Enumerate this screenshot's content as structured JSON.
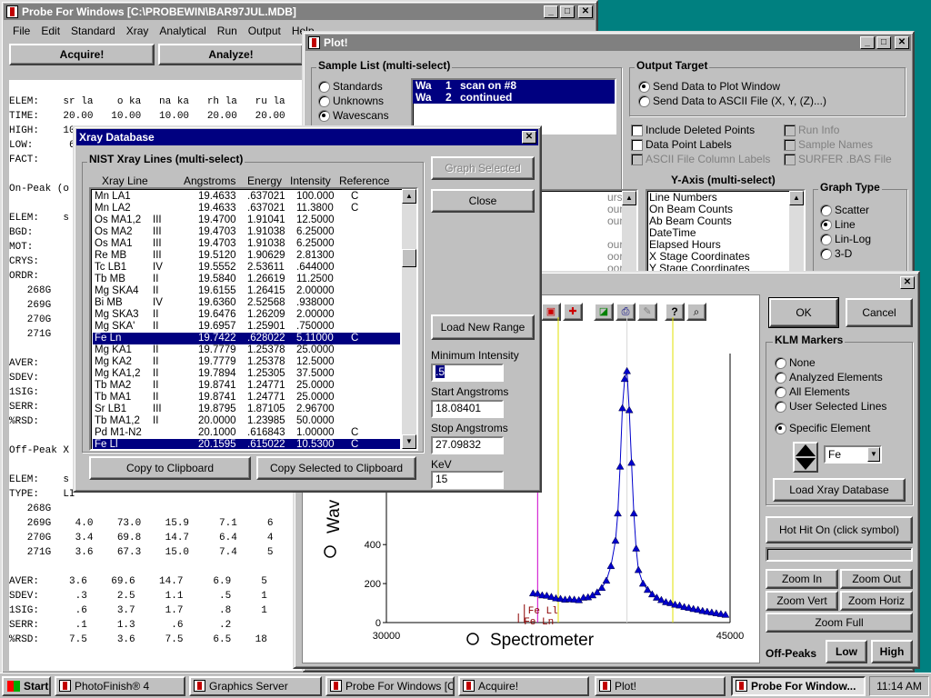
{
  "colors": {
    "desktop": "#008080",
    "titlebar_active": "#000080",
    "selection": "#000080",
    "marker": "#0000cc",
    "fe_line": "#8b0000",
    "klm_magenta": "#cc00cc",
    "klm_yellow": "#e0e000"
  },
  "probe": {
    "title": "Probe For Windows [C:\\PROBEWIN\\BAR97JUL.MDB]",
    "menu": [
      "File",
      "Edit",
      "Standard",
      "Xray",
      "Analytical",
      "Run",
      "Output",
      "Help"
    ],
    "acquire_label": "Acquire!",
    "analyze_label": "Analyze!",
    "lines": [
      "",
      "ELEM:    sr la    o ka   na ka   rh la   ru la",
      "TIME:    20.00   10.00   10.00   20.00   20.00",
      "HIGH:    10.00    5.00    5.00   10.00   10.00",
      "LOW:      6.00    5.00    5.00    6.00    6.00",
      "FACT:",
      "",
      "On-Peak (o",
      "",
      "ELEM:    s",
      "BGD:",
      "MOT:",
      "CRYS:",
      "ORDR:",
      "   268G    4",
      "   269G    4",
      "   270G    4",
      "   271G    4",
      "",
      "AVER:",
      "SDEV:",
      "1SIG:",
      "SERR:",
      "%RSD:",
      "",
      "Off-Peak X",
      "",
      "ELEM:    s",
      "TYPE:    LI",
      "   268G",
      "   269G    4.0    73.0    15.9     7.1     6",
      "   270G    3.4    69.8    14.7     6.4     4",
      "   271G    3.6    67.3    15.0     7.4     5",
      "",
      "AVER:     3.6    69.6    14.7     6.9     5",
      "SDEV:      .3     2.5     1.1      .5     1",
      "1SIG:      .6     3.7     1.7      .8     1",
      "SERR:      .1     1.3      .6      .2",
      "%RSD:     7.5     3.6     7.5     6.5    18"
    ]
  },
  "plot": {
    "title": "Plot!",
    "sample_list_label": "Sample List (multi-select)",
    "sample_types": [
      "Standards",
      "Unknowns",
      "Wavescans"
    ],
    "sample_items": [
      {
        "col1": "Wa",
        "col2": "1",
        "text": "scan on #8"
      },
      {
        "col1": "Wa",
        "col2": "2",
        "text": "continued"
      }
    ],
    "output_target_label": "Output Target",
    "output_options": [
      "Send Data to Plot Window",
      "Send Data to ASCII File (X, Y, (Z)...)"
    ],
    "checks_left": [
      "Include Deleted Points",
      "Data Point Labels",
      "ASCII File Column Labels"
    ],
    "checks_right": [
      "Run Info",
      "Sample Names",
      "SURFER .BAS File"
    ],
    "x_partial_items": [
      "urs",
      "ounts",
      "ounts",
      "",
      "ours",
      "oordinates",
      "oordinates"
    ],
    "y_axis_label": "Y-Axis (multi-select)",
    "y_items": [
      "Line Numbers",
      "On Beam Counts",
      "Ab Beam Counts",
      "DateTime",
      "Elapsed Hours",
      "X Stage Coordinates",
      "Y Stage Coordinates"
    ],
    "graph_type_label": "Graph Type",
    "graph_types": [
      "Scatter",
      "Line",
      "Lin-Log",
      "3-D"
    ]
  },
  "graph": {
    "ok_label": "OK",
    "cancel_label": "Cancel",
    "klm_label": "KLM Markers",
    "klm_options": [
      "None",
      "Analyzed Elements",
      "All Elements",
      "User Selected Lines",
      "Specific Element"
    ],
    "element_value": "Fe",
    "load_xray_label": "Load Xray Database",
    "hot_hit_label": "Hot Hit On (click symbol)",
    "zoom_in_label": "Zoom In",
    "zoom_out_label": "Zoom Out",
    "zoom_vert_label": "Zoom Vert",
    "zoom_horiz_label": "Zoom Horiz",
    "zoom_full_label": "Zoom Full",
    "off_peaks_label": "Off-Peaks",
    "low_label": "Low",
    "high_label": "High"
  },
  "xray": {
    "title": "Xray Database",
    "list_label": "NIST Xray Lines (multi-select)",
    "columns": [
      "Xray Line",
      "Angstroms",
      "Energy",
      "Intensity",
      "Reference"
    ],
    "rows": [
      {
        "line": "Mn LA1",
        "order": "",
        "ang": "19.4633",
        "energy": ".637021",
        "intensity": "100.000",
        "ref": "C",
        "sel": false
      },
      {
        "line": "Mn LA2",
        "order": "",
        "ang": "19.4633",
        "energy": ".637021",
        "intensity": "11.3800",
        "ref": "C",
        "sel": false
      },
      {
        "line": "Os MA1,2",
        "order": "III",
        "ang": "19.4700",
        "energy": "1.91041",
        "intensity": "12.5000",
        "ref": "",
        "sel": false
      },
      {
        "line": "Os MA2",
        "order": "III",
        "ang": "19.4703",
        "energy": "1.91038",
        "intensity": "6.25000",
        "ref": "",
        "sel": false
      },
      {
        "line": "Os MA1",
        "order": "III",
        "ang": "19.4703",
        "energy": "1.91038",
        "intensity": "6.25000",
        "ref": "",
        "sel": false
      },
      {
        "line": "Re MB",
        "order": "III",
        "ang": "19.5120",
        "energy": "1.90629",
        "intensity": "2.81300",
        "ref": "",
        "sel": false
      },
      {
        "line": "Tc LB1",
        "order": "IV",
        "ang": "19.5552",
        "energy": "2.53611",
        "intensity": ".644000",
        "ref": "",
        "sel": false
      },
      {
        "line": "Tb MB",
        "order": "II",
        "ang": "19.5840",
        "energy": "1.26619",
        "intensity": "11.2500",
        "ref": "",
        "sel": false
      },
      {
        "line": "Mg SKA4",
        "order": "II",
        "ang": "19.6155",
        "energy": "1.26415",
        "intensity": "2.00000",
        "ref": "",
        "sel": false
      },
      {
        "line": "Bi MB",
        "order": "IV",
        "ang": "19.6360",
        "energy": "2.52568",
        "intensity": ".938000",
        "ref": "",
        "sel": false
      },
      {
        "line": "Mg SKA3",
        "order": "II",
        "ang": "19.6476",
        "energy": "1.26209",
        "intensity": "2.00000",
        "ref": "",
        "sel": false
      },
      {
        "line": "Mg SKA'",
        "order": "II",
        "ang": "19.6957",
        "energy": "1.25901",
        "intensity": ".750000",
        "ref": "",
        "sel": false
      },
      {
        "line": "Fe Ln",
        "order": "",
        "ang": "19.7422",
        "energy": ".628022",
        "intensity": "5.11000",
        "ref": "C",
        "sel": true
      },
      {
        "line": "Mg KA1",
        "order": "II",
        "ang": "19.7779",
        "energy": "1.25378",
        "intensity": "25.0000",
        "ref": "",
        "sel": false
      },
      {
        "line": "Mg KA2",
        "order": "II",
        "ang": "19.7779",
        "energy": "1.25378",
        "intensity": "12.5000",
        "ref": "",
        "sel": false
      },
      {
        "line": "Mg KA1,2",
        "order": "II",
        "ang": "19.7894",
        "energy": "1.25305",
        "intensity": "37.5000",
        "ref": "",
        "sel": false
      },
      {
        "line": "Tb MA2",
        "order": "II",
        "ang": "19.8741",
        "energy": "1.24771",
        "intensity": "25.0000",
        "ref": "",
        "sel": false
      },
      {
        "line": "Tb MA1",
        "order": "II",
        "ang": "19.8741",
        "energy": "1.24771",
        "intensity": "25.0000",
        "ref": "",
        "sel": false
      },
      {
        "line": "Sr LB1",
        "order": "III",
        "ang": "19.8795",
        "energy": "1.87105",
        "intensity": "2.96700",
        "ref": "",
        "sel": false
      },
      {
        "line": "Tb MA1,2",
        "order": "II",
        "ang": "20.0000",
        "energy": "1.23985",
        "intensity": "50.0000",
        "ref": "",
        "sel": false
      },
      {
        "line": "Pd M1-N2",
        "order": "",
        "ang": "20.1000",
        "energy": ".616843",
        "intensity": "1.00000",
        "ref": "C",
        "sel": false
      },
      {
        "line": "Fe Ll",
        "order": "",
        "ang": "20.1595",
        "energy": ".615022",
        "intensity": "10.5300",
        "ref": "C",
        "sel": true
      }
    ],
    "graph_selected_label": "Graph Selected",
    "close_label": "Close",
    "load_range_label": "Load New Range",
    "min_intensity_label": "Minimum Intensity",
    "min_intensity_value": ".5",
    "start_ang_label": "Start Angstroms",
    "start_ang_value": "18.08401",
    "stop_ang_label": "Stop Angstroms",
    "stop_ang_value": "27.09832",
    "kev_label": "KeV",
    "kev_value": "15",
    "copy_label": "Copy to Clipboard",
    "copy_selected_label": "Copy Selected to Clipboard"
  },
  "chart_data": {
    "type": "scatter",
    "x_label": "Spectrometer",
    "y_label": "Wav",
    "x_ticks": [
      "30000",
      "45000"
    ],
    "y_ticks": [
      "0",
      "200",
      "400"
    ],
    "xlim": [
      30000,
      45000
    ],
    "ylim": [
      0,
      1380
    ],
    "peak_labels": [
      "Fe Ll",
      "Fe Ln"
    ],
    "peak_label_x": [
      36180,
      36000
    ],
    "klm_lines_x": [
      36600,
      37500,
      40500,
      42500
    ],
    "x": [
      36400,
      36600,
      36800,
      37000,
      37200,
      37400,
      37600,
      37800,
      38000,
      38200,
      38400,
      38600,
      38800,
      39000,
      39200,
      39400,
      39600,
      39800,
      40000,
      40100,
      40200,
      40300,
      40400,
      40500,
      40600,
      40700,
      40800,
      40900,
      41000,
      41200,
      41400,
      41600,
      41800,
      42000,
      42200,
      42400,
      42600,
      42800,
      43000,
      43200,
      43400,
      43600,
      43800,
      44000,
      44200,
      44400,
      44600,
      44800
    ],
    "values": [
      150,
      148,
      140,
      138,
      132,
      125,
      122,
      118,
      120,
      118,
      115,
      128,
      130,
      140,
      155,
      178,
      215,
      290,
      420,
      560,
      800,
      1100,
      1250,
      1290,
      1090,
      820,
      560,
      380,
      270,
      200,
      168,
      145,
      128,
      116,
      105,
      100,
      92,
      88,
      80,
      76,
      70,
      66,
      60,
      56,
      52,
      48,
      44,
      40
    ]
  },
  "taskbar": {
    "start_label": "Start",
    "tasks": [
      "PhotoFinish® 4",
      "Graphics Server",
      "Probe For Windows [C:...",
      "Acquire!",
      "Plot!",
      "Probe For Window..."
    ],
    "clock": "11:14 AM"
  }
}
